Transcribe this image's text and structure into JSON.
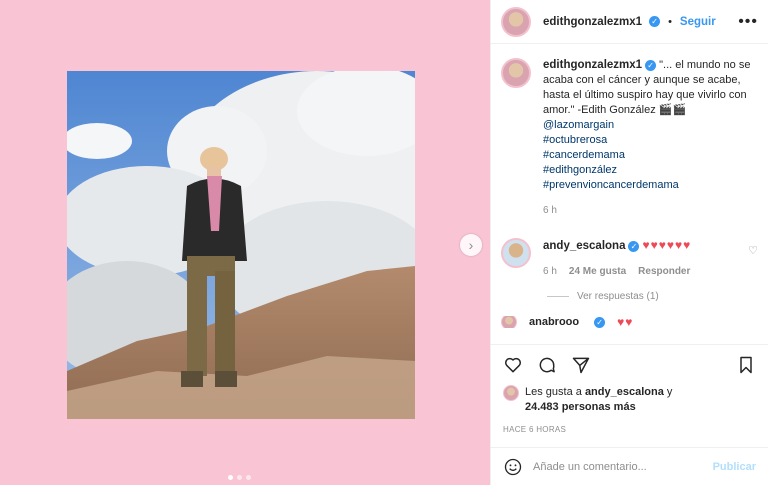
{
  "post": {
    "username": "edithgonzalezmx1",
    "follow_label": "Seguir",
    "more_label": "•••",
    "caption": {
      "username": "edithgonzalezmx1",
      "text": "\"... el mundo no se acaba con el cáncer y aunque se acabe, hasta el último suspiro hay que vivirlo con amor.\" -Edith González 🎬🎬",
      "mention": "@lazomargain",
      "hashtags": [
        "#octubrerosa",
        "#cancerdemama",
        "#edithgonzález",
        "#prevenvioncancerdemama"
      ],
      "time": "6 h"
    },
    "comments": [
      {
        "username": "andy_escalona",
        "text": "♥♥♥♥♥♥",
        "time": "6 h",
        "likes": "24 Me gusta",
        "reply_label": "Responder",
        "view_replies": "Ver respuestas (1)"
      },
      {
        "username": "anabrooo",
        "text": "♥♥"
      }
    ],
    "liked_by": {
      "prefix": "Les gusta a",
      "user": "andy_escalona",
      "and": "y",
      "count": "24.483 personas más"
    },
    "posted_ago": "HACE 6 HORAS",
    "comment_placeholder": "Añade un comentario...",
    "publish_label": "Publicar",
    "carousel": {
      "slides": 3,
      "active": 0
    }
  },
  "colors": {
    "background": "#f9c4d4",
    "link": "#3897f0",
    "heart": "#ed4956",
    "muted": "#8e8e8e"
  },
  "icons": [
    "heart-icon",
    "comment-icon",
    "share-icon",
    "bookmark-icon",
    "emoji-icon",
    "chevron-right-icon",
    "verified-icon",
    "more-icon"
  ]
}
